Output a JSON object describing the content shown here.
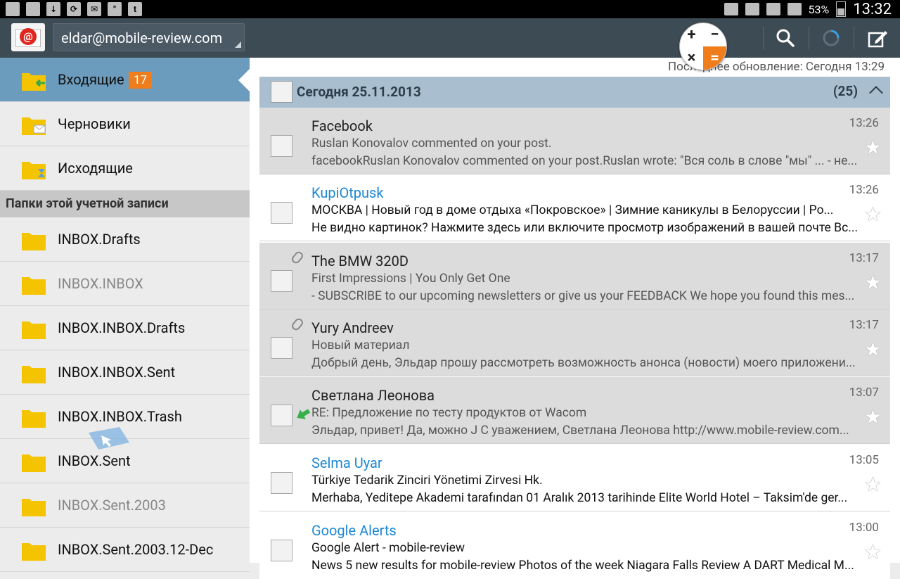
{
  "status_bar": {
    "battery": "53%",
    "time": "13:32"
  },
  "action_bar": {
    "account": "eldar@mobile-review.com"
  },
  "sidebar": {
    "items": [
      {
        "label": "Входящие",
        "badge": "17"
      },
      {
        "label": "Черновики"
      },
      {
        "label": "Исходящие"
      }
    ],
    "section_header": "Папки этой учетной записи",
    "folders": [
      {
        "label": "INBOX.Drafts"
      },
      {
        "label": "INBOX.INBOX"
      },
      {
        "label": "INBOX.INBOX.Drafts"
      },
      {
        "label": "INBOX.INBOX.Sent"
      },
      {
        "label": "INBOX.INBOX.Trash"
      },
      {
        "label": "INBOX.Sent"
      },
      {
        "label": "INBOX.Sent.2003"
      },
      {
        "label": "INBOX.Sent.2003.12-Dec"
      }
    ]
  },
  "main": {
    "last_update": "Последнее обновление:  Сегодня 13:29",
    "group": {
      "label": "Сегодня  25.11.2013",
      "count": "(25)"
    },
    "messages": [
      {
        "from": "Facebook",
        "subject": "Ruslan Konovalov commented on your post.",
        "preview": "facebookRuslan Konovalov commented on your post.Ruslan wrote: \"Вся соль в слове \"мы\" ... - не...",
        "time": "13:26"
      },
      {
        "from": "KupiOtpusk",
        "subject": "МОСКВА | Новый год в доме отдыха «Покровское» | Зимние каникулы в Белоруссии | Ро...",
        "preview": "Не видно картинок? Нажмите здесь или включите просмотр изображений в вашей почте Вс...",
        "time": "13:26"
      },
      {
        "from": "The BMW 320D",
        "subject": "First Impressions | You Only Get One",
        "preview": "- SUBSCRIBE to our upcoming newsletters or give us your FEEDBACK We hope you found this mes...",
        "time": "13:17"
      },
      {
        "from": "Yury Andreev",
        "subject": "Новый материал",
        "preview": "Добрый день, Эльдар прошу рассмотреть возможность анонса (новости) моего приложени...",
        "time": "13:17"
      },
      {
        "from": "Светлана Леонова",
        "subject": "RE: Предложение по тесту продуктов от Wacom",
        "preview": "Эльдар, привет! Да, можно J С уважением, Светлана Леонова http://www.mobile-review.com...",
        "time": "13:07"
      },
      {
        "from": "Selma Uyar",
        "subject": "Türkiye Tedarik Zinciri Yönetimi Zirvesi Hk.",
        "preview": " Merhaba, Yeditepe Akademi tarafından 01 Aralık 2013 tarihinde Elite World Hotel – Taksim'de ger...",
        "time": "13:05"
      },
      {
        "from": "Google Alerts",
        "subject": "Google Alert - mobile-review",
        "preview": "News 5 new results for mobile-review Photos of the week Niagara Falls Review A DART Medical M...",
        "time": "13:00"
      }
    ]
  },
  "colors": {
    "action_bar": "#3d4b55",
    "selected_folder": "#6c9cbd",
    "badge": "#ef7d1b",
    "group_header": "#a9bfd0",
    "unread_sender": "#1e88d2"
  }
}
